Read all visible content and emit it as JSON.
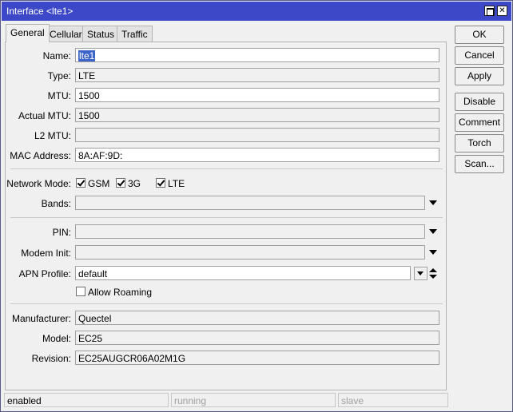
{
  "window": {
    "title": "Interface <lte1>"
  },
  "tabs": [
    {
      "label": "General",
      "active": true
    },
    {
      "label": "Cellular",
      "active": false
    },
    {
      "label": "Status",
      "active": false
    },
    {
      "label": "Traffic",
      "active": false
    }
  ],
  "general": {
    "name": {
      "label": "Name:",
      "value": "lte1"
    },
    "type": {
      "label": "Type:",
      "value": "LTE"
    },
    "mtu": {
      "label": "MTU:",
      "value": "1500"
    },
    "actual_mtu": {
      "label": "Actual MTU:",
      "value": "1500"
    },
    "l2_mtu": {
      "label": "L2 MTU:",
      "value": ""
    },
    "mac_address": {
      "label": "MAC Address:",
      "value": "8A:AF:9D:"
    },
    "network_mode": {
      "label": "Network Mode:",
      "options": [
        {
          "label": "GSM",
          "checked": true
        },
        {
          "label": "3G",
          "checked": true
        },
        {
          "label": "LTE",
          "checked": true
        }
      ]
    },
    "bands": {
      "label": "Bands:",
      "value": ""
    },
    "pin": {
      "label": "PIN:",
      "value": ""
    },
    "modem_init": {
      "label": "Modem Init:",
      "value": ""
    },
    "apn_profile": {
      "label": "APN Profile:",
      "value": "default"
    },
    "allow_roaming": {
      "label": "Allow Roaming",
      "checked": false
    },
    "manufacturer": {
      "label": "Manufacturer:",
      "value": "Quectel"
    },
    "model": {
      "label": "Model:",
      "value": "EC25"
    },
    "revision": {
      "label": "Revision:",
      "value": "EC25AUGCR06A02M1G"
    }
  },
  "buttons": {
    "ok": "OK",
    "cancel": "Cancel",
    "apply": "Apply",
    "disable": "Disable",
    "comment": "Comment",
    "torch": "Torch",
    "scan": "Scan..."
  },
  "status_bar": {
    "state": "enabled",
    "running": "running",
    "slave": "slave"
  },
  "colors": {
    "titlebar": "#3d48c8",
    "selection": "#3d64c8"
  }
}
